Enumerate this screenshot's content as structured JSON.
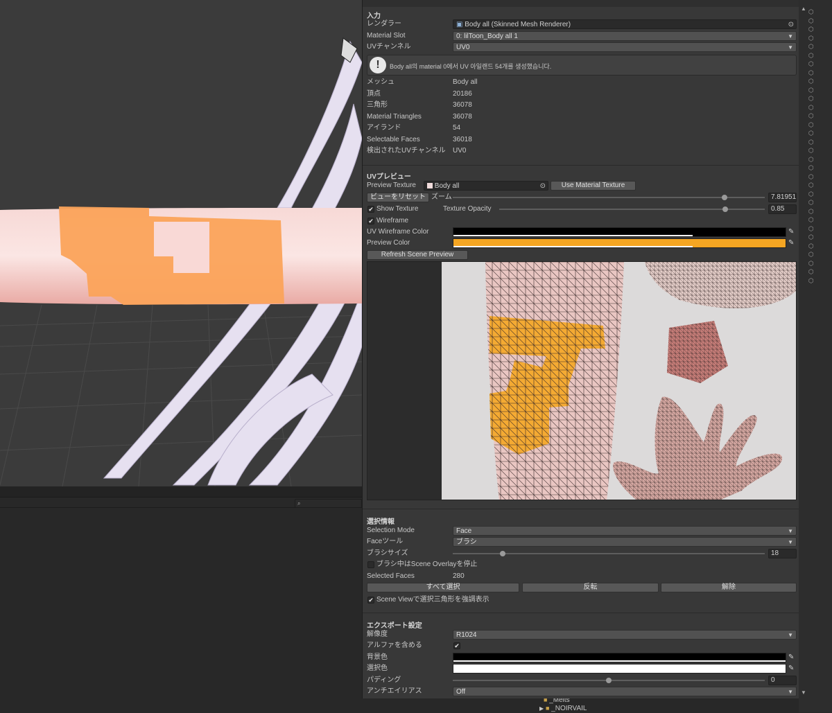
{
  "inspector": {
    "input": {
      "header": "入力",
      "renderer_label": "レンダラー",
      "renderer_value": "Body all (Skinned Mesh Renderer)",
      "material_slot_label": "Material Slot",
      "material_slot_value": "0: lilToon_Body all 1",
      "uv_channel_label": "UVチャンネル",
      "uv_channel_value": "UV0",
      "info_message": "Body all의 material 0에서 UV 아일랜드 54개를 생성했습니다."
    },
    "stats": [
      {
        "label": "メッシュ",
        "value": "Body all"
      },
      {
        "label": "頂点",
        "value": "20186"
      },
      {
        "label": "三角形",
        "value": "36078"
      },
      {
        "label": "Material Triangles",
        "value": "36078"
      },
      {
        "label": "アイランド",
        "value": "54"
      },
      {
        "label": "Selectable Faces",
        "value": "36018"
      },
      {
        "label": "検出されたUVチャンネル",
        "value": "UV0"
      }
    ],
    "uv_preview": {
      "header": "UVプレビュー",
      "preview_texture_label": "Preview Texture",
      "preview_texture_value": "Body all",
      "use_material_texture_button": "Use Material Texture",
      "reset_view_button": "ビューをリセット",
      "zoom_label": "ズーム",
      "zoom_value": "7.81951",
      "zoom_fraction": 0.87,
      "show_texture_label": "Show Texture",
      "texture_opacity_label": "Texture Opacity",
      "texture_opacity_value": "0.85",
      "texture_opacity_fraction": 0.85,
      "wireframe_label": "Wireframe",
      "uv_wireframe_color_label": "UV Wireframe Color",
      "uv_wireframe_color": "#000000",
      "preview_color_label": "Preview Color",
      "preview_color": "#f5a623",
      "refresh_button": "Refresh Scene Preview"
    },
    "selection": {
      "header": "選択情報",
      "selection_mode_label": "Selection Mode",
      "selection_mode_value": "Face",
      "face_tool_label": "Faceツール",
      "face_tool_value": "ブラシ",
      "brush_size_label": "ブラシサイズ",
      "brush_size_value": "18",
      "brush_size_fraction": 0.16,
      "stop_overlay_label": "ブラシ中はScene Overlayを停止",
      "selected_faces_label": "Selected Faces",
      "selected_faces_value": "280",
      "select_all_button": "すべて選択",
      "invert_button": "反転",
      "clear_button": "解除",
      "highlight_label": "Scene Viewで選択三角形を強調表示"
    },
    "export": {
      "header": "エクスポート設定",
      "resolution_label": "解像度",
      "resolution_value": "R1024",
      "include_alpha_label": "アルファを含める",
      "bg_color_label": "背景色",
      "bg_color": "#000000",
      "sel_color_label": "選択色",
      "sel_color": "#ffffff",
      "padding_label": "パディング",
      "padding_value": "0",
      "padding_fraction": 0.5,
      "antialias_label": "アンチエイリアス",
      "antialias_value": "Off"
    }
  },
  "project_tree": [
    {
      "label": "_Melts"
    },
    {
      "label": "_NOIRVAIL"
    }
  ],
  "accent_orange": "#f5a623"
}
